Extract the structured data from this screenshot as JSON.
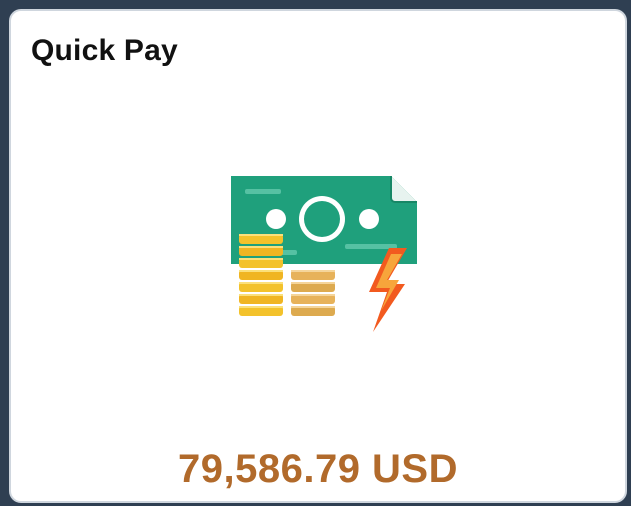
{
  "tile": {
    "title": "Quick Pay",
    "amount": "79,586.79 USD",
    "icon": "money-bill-coins-lightning-icon"
  },
  "colors": {
    "amount_text": "#b16a2b",
    "bill_green": "#1fa07c",
    "coin_gold": "#f2b924",
    "bolt_orange": "#f25a1f"
  }
}
